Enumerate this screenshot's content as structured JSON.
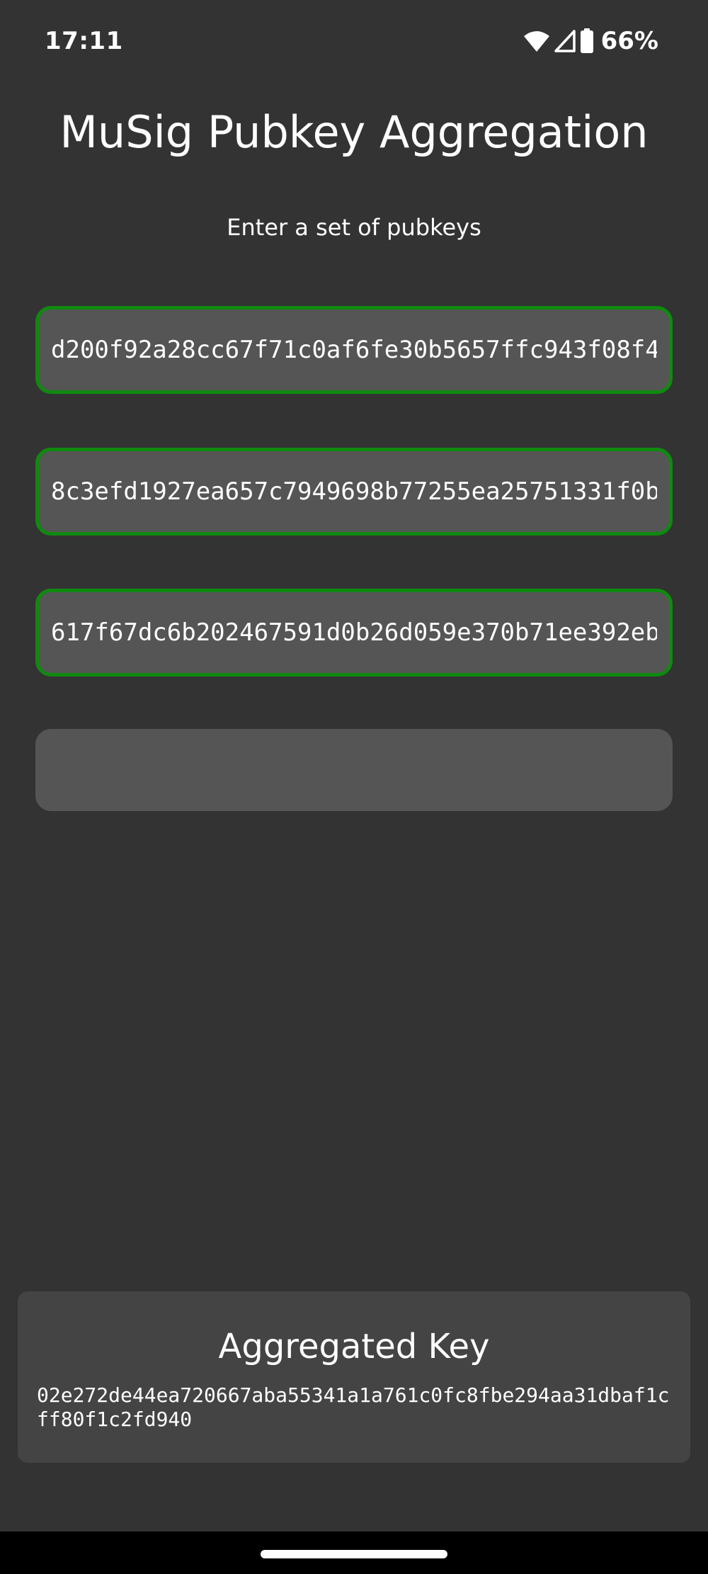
{
  "status_bar": {
    "time": "17:11",
    "battery": "66%",
    "icons": [
      "wifi-icon",
      "cell-signal-icon",
      "battery-icon"
    ]
  },
  "page": {
    "title": "MuSig Pubkey Aggregation",
    "subtitle": "Enter a set of pubkeys"
  },
  "inputs": [
    {
      "value": "d200f92a28cc67f71c0af6fe30b5657ffc943f08f4",
      "placeholder": "",
      "valid": true
    },
    {
      "value": "8c3efd1927ea657c7949698b77255ea25751331f0b",
      "placeholder": "",
      "valid": true
    },
    {
      "value": "617f67dc6b202467591d0b26d059e370b71ee392eb",
      "placeholder": "",
      "valid": true
    },
    {
      "value": "",
      "placeholder": "",
      "valid": false
    }
  ],
  "result": {
    "title": "Aggregated Key",
    "value": "02e272de44ea720667aba55341a1a761c0fc8fbe294aa31dbaf1cff80f1c2fd940"
  },
  "colors": {
    "background": "#333333",
    "input_bg": "#555555",
    "valid_border": "#0f8a0f",
    "card_bg": "#444444"
  }
}
